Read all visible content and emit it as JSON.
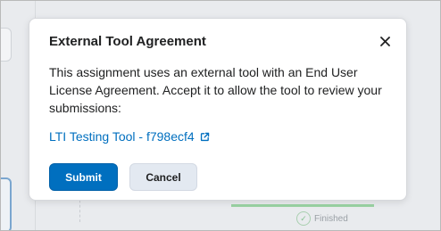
{
  "dialog": {
    "title": "External Tool Agreement",
    "close_icon": "close-icon",
    "body_text": "This assignment uses an external tool with an End User License Agreement. Accept it to allow the tool to review your submissions:",
    "link_text": "LTI Testing Tool - f798ecf4",
    "link_icon": "external-link-icon",
    "submit_label": "Submit",
    "cancel_label": "Cancel"
  },
  "background": {
    "status_text": "Finished",
    "status_icon": "check-circle-icon"
  },
  "colors": {
    "primary": "#006fbf",
    "secondary_button": "#e3e9f1",
    "text": "#202122",
    "overlay": "#e9ebee"
  }
}
